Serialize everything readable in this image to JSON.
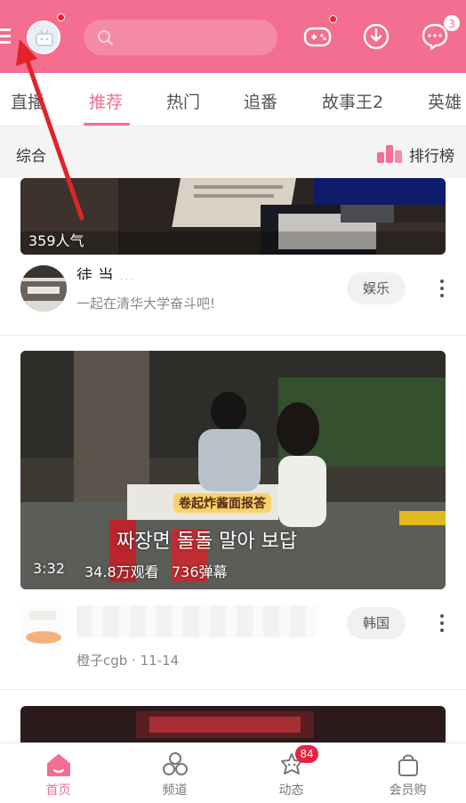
{
  "header": {
    "notification_count": "3",
    "search_placeholder": ""
  },
  "tabs": [
    {
      "label": "直播"
    },
    {
      "label": "推荐"
    },
    {
      "label": "热门"
    },
    {
      "label": "追番"
    },
    {
      "label": "故事王2"
    },
    {
      "label": "英雄"
    }
  ],
  "subbar": {
    "left_label": "综合",
    "rank_label": "排行榜"
  },
  "feed": [
    {
      "popularity": "359人气",
      "title_partial": "徒 当 ...",
      "subtitle": "一起在清华大学奋斗吧!",
      "tag": "娱乐"
    },
    {
      "duration": "3:32",
      "views": "34.8万观看",
      "danmaku": "736弹幕",
      "caption_cn": "卷起炸酱面报答",
      "caption_kr": "짜장면 돌돌 말아 보답",
      "author_date": "橙子cgb · 11-14",
      "tag": "韩国"
    }
  ],
  "bottom_nav": [
    {
      "label": "首页"
    },
    {
      "label": "频道"
    },
    {
      "label": "动态",
      "badge": "84"
    },
    {
      "label": "会员购"
    }
  ],
  "colors": {
    "brand_pink": "#f36e8f",
    "badge_red": "#e5223f",
    "arrow_red": "#e0242a"
  },
  "icons": {
    "menu": "menu-icon",
    "search": "search-icon",
    "game": "gamepad-icon",
    "download": "download-icon",
    "message": "message-icon",
    "rank": "bar-chart-icon",
    "home": "home-icon",
    "channel": "channel-icon",
    "feed": "dynamic-icon",
    "shop": "shopping-bag-icon"
  }
}
